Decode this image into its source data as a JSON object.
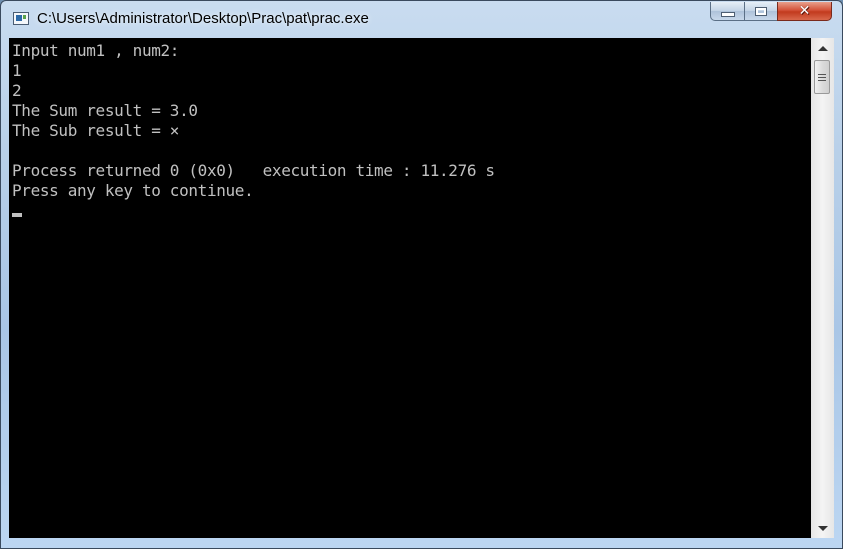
{
  "window": {
    "title": "C:\\Users\\Administrator\\Desktop\\Prac\\pat\\prac.exe",
    "icon": "console-app-icon",
    "buttons": {
      "minimize": "minimize-icon",
      "maximize": "maximize-icon",
      "close": "close-icon",
      "close_glyph": "✕"
    }
  },
  "console": {
    "lines": [
      "Input num1 , num2:",
      "1",
      "2",
      "The Sum result = 3.0",
      "The Sub result = ×",
      "",
      "Process returned 0 (0x0)   execution time : 11.276 s",
      "Press any key to continue."
    ],
    "background": "#000000",
    "foreground": "#c0c0c0"
  },
  "scrollbar": {
    "up_icon": "scroll-up-arrow-icon",
    "down_icon": "scroll-down-arrow-icon",
    "position": 0
  }
}
